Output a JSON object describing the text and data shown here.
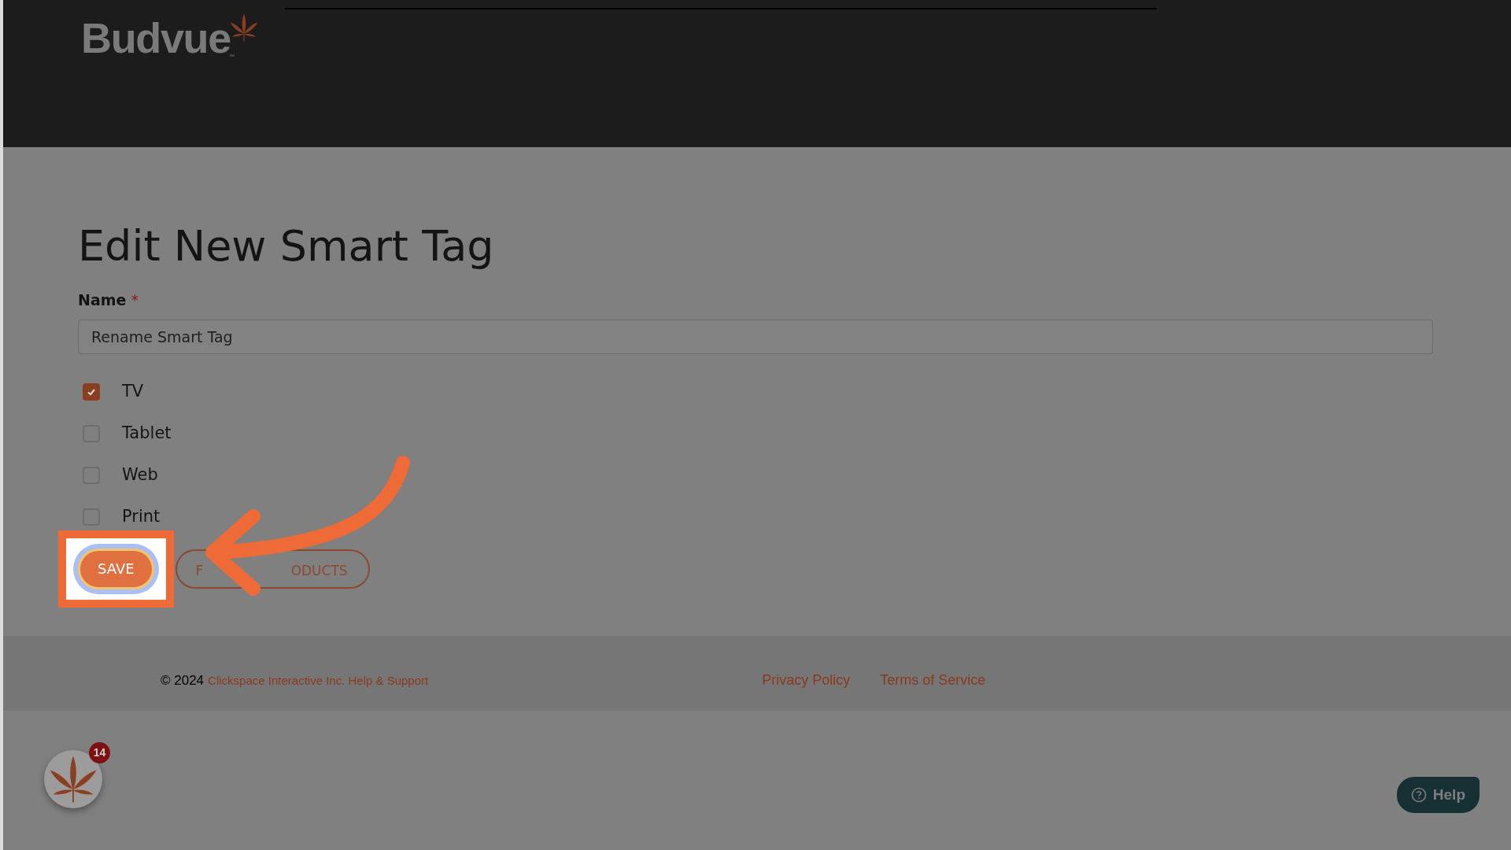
{
  "header": {
    "logo": {
      "name": "Budvue",
      "trademark": "™"
    }
  },
  "page": {
    "title": "Edit New Smart Tag"
  },
  "form": {
    "name_field": {
      "label": "Name",
      "required_mark": "*",
      "value": "Rename Smart Tag"
    },
    "channels": [
      {
        "label": "TV",
        "checked": true
      },
      {
        "label": "Tablet",
        "checked": false
      },
      {
        "label": "Web",
        "checked": false
      },
      {
        "label": "Print",
        "checked": false
      }
    ],
    "buttons": [
      {
        "kind": "primary",
        "label": "SAVE",
        "highlighted": true
      },
      {
        "kind": "outline",
        "label_start": "F",
        "label_end": "ODUCTS",
        "highlighted": false
      }
    ]
  },
  "footer": {
    "copyright": "© 2024",
    "company_link": "Clickspace Interactive Inc. Help & Support",
    "links": [
      "Privacy Policy",
      "Terms of Service"
    ]
  },
  "notifications": {
    "count": "14"
  },
  "help_button": {
    "label": "Help"
  }
}
